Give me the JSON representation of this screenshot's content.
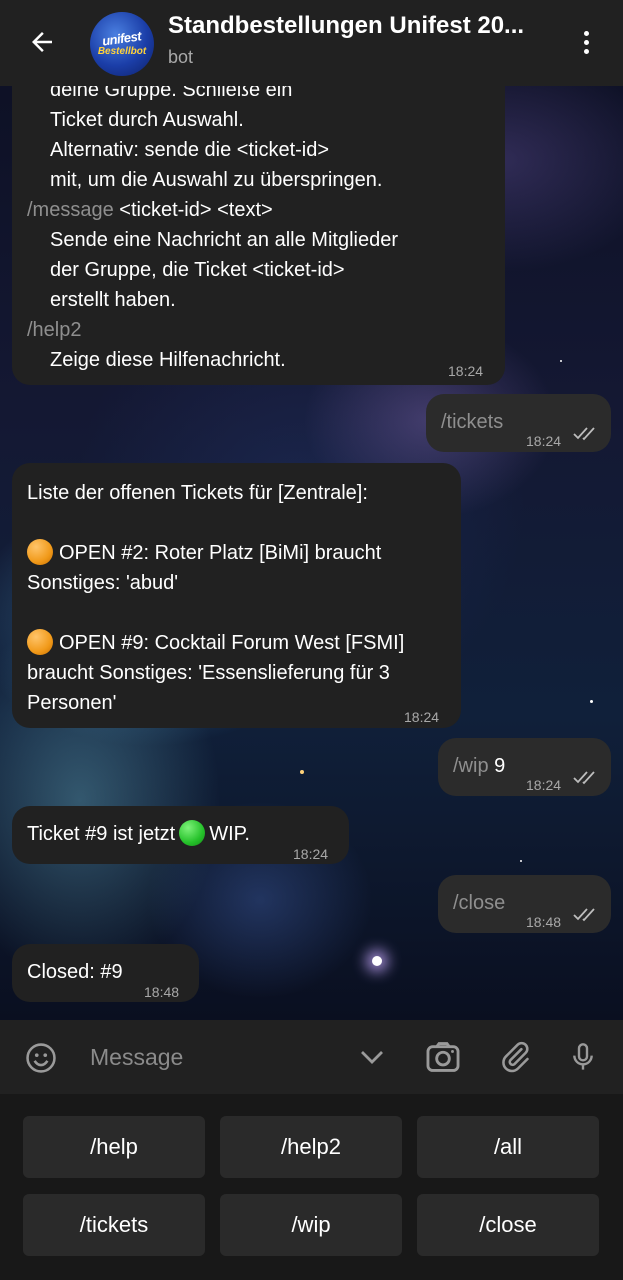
{
  "header": {
    "title": "Standbestellungen Unifest 20...",
    "subtitle": "bot",
    "avatar_text_top": "unifest",
    "avatar_text_bottom": "Bestellbot"
  },
  "messages": {
    "help": {
      "lines": [
        "deine Gruppe. Schließe ein",
        "Ticket durch Auswahl.",
        "Alternativ: sende die <ticket-id>",
        "mit, um die Auswahl zu überspringen."
      ],
      "cmd_message": "/message",
      "cmd_message_args": " <ticket-id> <text>",
      "message_desc": [
        "Sende eine Nachricht an alle Mitglieder",
        "der Gruppe, die Ticket <ticket-id>",
        "erstellt haben."
      ],
      "cmd_help2": "/help2",
      "help2_desc": "Zeige diese Hilfenachricht.",
      "time": "18:24"
    },
    "tickets_cmd": {
      "text": "/tickets",
      "time": "18:24"
    },
    "tickets_list": {
      "header": "Liste der offenen Tickets für [Zentrale]:",
      "t1_line1": "OPEN #2: Roter Platz [BiMi] braucht",
      "t1_line2": "Sonstiges: 'abud'",
      "t2_line1": "OPEN #9: Cocktail Forum West [FSMI]",
      "t2_line2": "braucht Sonstiges: 'Essenslieferung für 3",
      "t2_line3": "Personen'",
      "time": "18:24"
    },
    "wip_cmd": {
      "cmd": "/wip",
      "arg": " 9",
      "time": "18:24"
    },
    "wip_reply": {
      "before": "Ticket #9 ist jetzt",
      "after": "WIP.",
      "time": "18:24"
    },
    "close_cmd": {
      "text": "/close",
      "time": "18:48"
    },
    "closed_reply": {
      "text": "Closed: #9",
      "time": "18:48"
    }
  },
  "input": {
    "placeholder": "Message"
  },
  "keyboard": {
    "row1": [
      "/help",
      "/help2",
      "/all"
    ],
    "row2": [
      "/tickets",
      "/wip",
      "/close"
    ]
  },
  "icons": {
    "back": "arrow-left-icon",
    "menu": "more-vertical-icon",
    "emoji": "smiley-icon",
    "keyboard_toggle": "chevron-down-icon",
    "camera": "camera-icon",
    "attach": "paperclip-icon",
    "mic": "microphone-icon",
    "read": "double-check-icon"
  },
  "colors": {
    "bubble_in": "#212121",
    "bubble_out": "#2b2b2b",
    "command_text": "#8f8f8f",
    "bar": "#212121"
  }
}
